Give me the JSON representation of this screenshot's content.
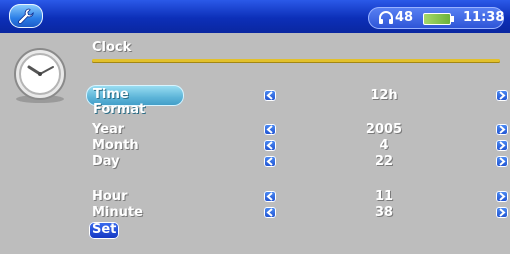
{
  "status": {
    "headphone_volume": "48",
    "time": "11:38"
  },
  "section": {
    "title": "Clock"
  },
  "time_format": {
    "label": "Time Format",
    "value": "12h"
  },
  "date": {
    "year": {
      "label": "Year",
      "value": "2005"
    },
    "month": {
      "label": "Month",
      "value": "4"
    },
    "day": {
      "label": "Day",
      "value": "22"
    }
  },
  "time": {
    "hour": {
      "label": "Hour",
      "value": "11"
    },
    "minute": {
      "label": "Minute",
      "value": "38"
    }
  },
  "actions": {
    "set_label": "Set"
  },
  "icons": [
    "wrench-icon",
    "headphones-icon",
    "battery-icon",
    "clock-icon",
    "chevron-left-icon",
    "chevron-right-icon"
  ],
  "colors": {
    "topbar": "#0c2fb8",
    "accent_line": "#e2c02b",
    "background": "#bdbdbd"
  }
}
